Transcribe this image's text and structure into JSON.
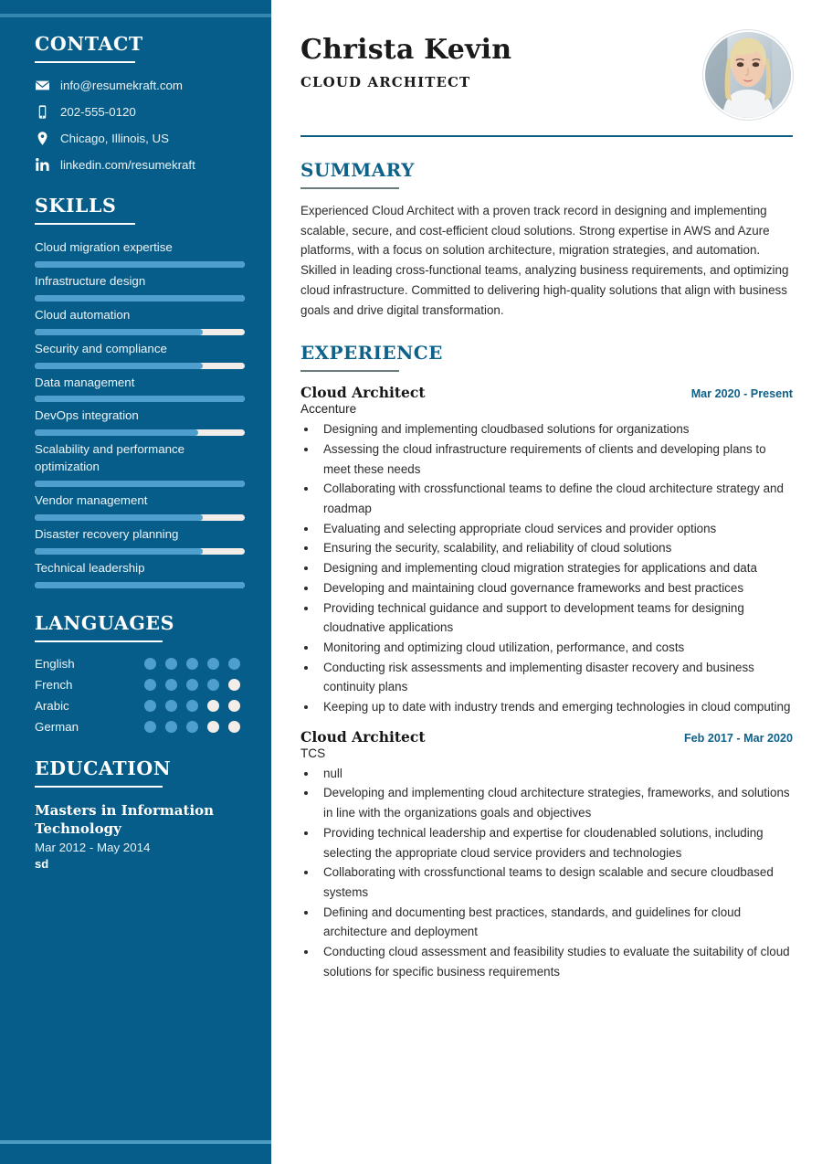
{
  "sidebar": {
    "contact": {
      "heading": "CONTACT",
      "items": [
        {
          "icon": "envelope-icon",
          "value": "info@resumekraft.com"
        },
        {
          "icon": "mobile-phone-icon",
          "value": "202-555-0120"
        },
        {
          "icon": "location-pin-icon",
          "value": "Chicago, Illinois, US"
        },
        {
          "icon": "linkedin-icon",
          "value": "linkedin.com/resumekraft"
        }
      ]
    },
    "skills": {
      "heading": "SKILLS",
      "items": [
        {
          "name": "Cloud migration expertise",
          "level": 100
        },
        {
          "name": "Infrastructure design",
          "level": 100
        },
        {
          "name": "Cloud automation",
          "level": 80
        },
        {
          "name": "Security and compliance",
          "level": 80
        },
        {
          "name": "Data management",
          "level": 100
        },
        {
          "name": "DevOps integration",
          "level": 78
        },
        {
          "name": "Scalability and performance optimization",
          "level": 100
        },
        {
          "name": "Vendor management",
          "level": 80
        },
        {
          "name": "Disaster recovery planning",
          "level": 80
        },
        {
          "name": "Technical leadership",
          "level": 100
        }
      ]
    },
    "languages": {
      "heading": "LANGUAGES",
      "max": 5,
      "items": [
        {
          "name": "English",
          "level": 5
        },
        {
          "name": "French",
          "level": 4
        },
        {
          "name": "Arabic",
          "level": 3
        },
        {
          "name": "German",
          "level": 3
        }
      ]
    },
    "education": {
      "heading": "EDUCATION",
      "items": [
        {
          "degree": "Masters in Information Technology",
          "date": "Mar 2012 - May 2014",
          "school": "sd"
        }
      ]
    }
  },
  "header": {
    "name": "Christa Kevin",
    "role": "CLOUD ARCHITECT",
    "avatar_alt": "profile-photo"
  },
  "main": {
    "summary": {
      "heading": "SUMMARY",
      "text": "Experienced Cloud Architect with a proven track record in designing and implementing scalable, secure, and cost-efficient cloud solutions. Strong expertise in AWS and Azure platforms, with a focus on solution architecture, migration strategies, and automation. Skilled in leading cross-functional teams, analyzing business requirements, and optimizing cloud infrastructure. Committed to delivering high-quality solutions that align with business goals and drive digital transformation."
    },
    "experience": {
      "heading": "EXPERIENCE",
      "jobs": [
        {
          "title": "Cloud Architect",
          "company": "Accenture",
          "date": "Mar 2020 - Present",
          "bullets": [
            "Designing and implementing cloudbased solutions for organizations",
            "Assessing the cloud infrastructure requirements of clients and developing plans to meet these needs",
            "Collaborating with crossfunctional teams to define the cloud architecture strategy and roadmap",
            "Evaluating and selecting appropriate cloud services and provider options",
            "Ensuring the security, scalability, and reliability of cloud solutions",
            "Designing and implementing cloud migration strategies for applications and data",
            "Developing and maintaining cloud governance frameworks and best practices",
            "Providing technical guidance and support to development teams for designing cloudnative applications",
            "Monitoring and optimizing cloud utilization, performance, and costs",
            "Conducting risk assessments and implementing disaster recovery and business continuity plans",
            "Keeping up to date with industry trends and emerging technologies in cloud computing"
          ]
        },
        {
          "title": "Cloud Architect",
          "company": "TCS",
          "date": "Feb 2017 - Mar 2020",
          "bullets": [
            "null",
            "Developing and implementing cloud architecture strategies, frameworks, and solutions in line with the organizations goals and objectives",
            "Providing technical leadership and expertise for cloudenabled solutions, including selecting the appropriate cloud service providers and technologies",
            "Collaborating with crossfunctional teams to design scalable and secure cloudbased systems",
            "Defining and documenting best practices, standards, and guidelines for cloud architecture and deployment",
            "Conducting cloud assessment and feasibility studies to evaluate the suitability of cloud solutions for specific business requirements"
          ]
        }
      ]
    }
  },
  "colors": {
    "sidebar_bg": "#075D89",
    "accent_blue": "#0E6189",
    "bar_fill": "#4E9FCD",
    "bar_track": "#F3EDEA"
  }
}
